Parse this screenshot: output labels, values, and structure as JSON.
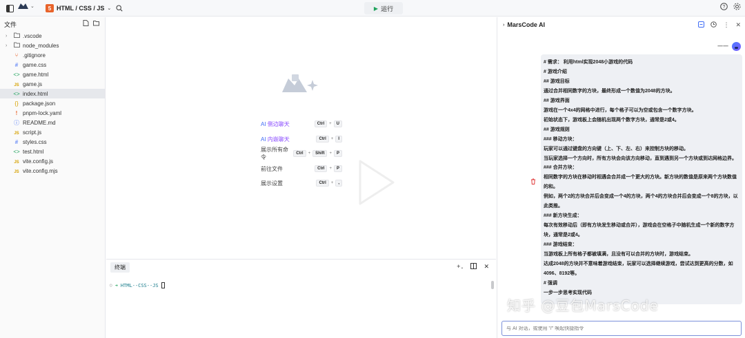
{
  "topbar": {
    "project_name": "HTML / CSS / JS",
    "run_label": "运行"
  },
  "sidebar": {
    "title": "文件",
    "files": [
      {
        "name": ".vscode",
        "type": "folder",
        "chevron": true,
        "icon": "folder-icon"
      },
      {
        "name": "node_modules",
        "type": "folder",
        "chevron": true,
        "icon": "folder-icon"
      },
      {
        "name": ".gitignore",
        "type": "git",
        "icon": "git-icon"
      },
      {
        "name": "game.css",
        "type": "css",
        "icon": "hash-icon"
      },
      {
        "name": "game.html",
        "type": "html",
        "icon": "code-icon"
      },
      {
        "name": "game.js",
        "type": "js",
        "icon": "js-icon"
      },
      {
        "name": "index.html",
        "type": "html",
        "icon": "code-icon",
        "active": true
      },
      {
        "name": "package.json",
        "type": "json",
        "icon": "braces-icon"
      },
      {
        "name": "pnpm-lock.yaml",
        "type": "yaml",
        "icon": "exclamation-icon"
      },
      {
        "name": "README.md",
        "type": "md",
        "icon": "info-icon"
      },
      {
        "name": "script.js",
        "type": "js",
        "icon": "js-icon"
      },
      {
        "name": "styles.css",
        "type": "css",
        "icon": "hash-icon"
      },
      {
        "name": "test.html",
        "type": "html",
        "icon": "code-icon"
      },
      {
        "name": "vite.config.js",
        "type": "js",
        "icon": "js-icon"
      },
      {
        "name": "vite.config.mjs",
        "type": "js",
        "icon": "js-icon"
      }
    ]
  },
  "welcome": {
    "commands": [
      {
        "label_prefix": "AI ",
        "label_rest": "侧边聊天",
        "keys": [
          "Ctrl",
          "U"
        ]
      },
      {
        "label_prefix": "AI ",
        "label_rest": "内嵌聊天",
        "keys": [
          "Ctrl",
          "I"
        ]
      },
      {
        "label_prefix": "",
        "label_rest": "展示所有命令",
        "keys": [
          "Ctrl",
          "Shift",
          "P"
        ]
      },
      {
        "label_prefix": "",
        "label_rest": "前往文件",
        "keys": [
          "Ctrl",
          "P"
        ]
      },
      {
        "label_prefix": "",
        "label_rest": "展示设置",
        "keys": [
          "Ctrl",
          ","
        ]
      }
    ]
  },
  "terminal": {
    "tab_label": "终端",
    "prompt_path": "HTML--CSS--JS"
  },
  "ai_panel": {
    "title": "MarsCode AI",
    "user_name": "一一",
    "message_lines": [
      "# 需求： 利用html实现2048小游戏的代码",
      "# 游戏介绍",
      "## 游戏目标",
      "通过合并相同数字的方块，最终形成一个数值为2048的方块。",
      "## 游戏界面",
      "游戏在一个4x4的网格中进行，每个格子可以为空或包含一个数字方块。",
      "初始状态下，游戏板上会随机出现两个数字方块，通常是2或4。",
      "## 游戏规则",
      "### 移动方块：",
      "玩家可以通过键盘的方向键（上、下、左、右）来控制方块的移动。",
      "当玩家选择一个方向时，所有方块会向该方向移动，直到遇到另一个方块或到达网格边界。",
      "### 合并方块：",
      "相同数字的方块在移动时相遇会合并成一个更大的方块。新方块的数值是原来两个方块数值的和。",
      "例如，两个2的方块合并后会变成一个4的方块，两个4的方块合并后会变成一个8的方块，以此类推。",
      "### 新方块生成：",
      "每次有效移动后（即有方块发生移动或合并），游戏会在空格子中随机生成一个新的数字方块，通常是2或4。",
      "### 游戏结束：",
      "当游戏板上所有格子都被填满，且没有可以合并的方块时，游戏结束。",
      "达成2048的方块并不意味着游戏结束，玩家可以选择继续游戏，尝试达到更高的分数，如4096、8192等。",
      "# 强调",
      "一步一步思考实现代码"
    ],
    "input_placeholder": "与 AI 对话，或使用 \"/\" 唤起快捷指令"
  },
  "watermark": "知乎 @豆包MarsCode"
}
